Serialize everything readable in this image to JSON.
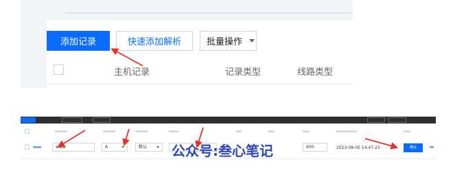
{
  "toolbar": {
    "add_record_label": "添加记录",
    "quick_add_label": "快速添加解析",
    "batch_label": "批量操作"
  },
  "table_header": {
    "host_record": "主机记录",
    "record_type": "记录类型",
    "line_type": "线路类型"
  },
  "edit_row": {
    "host_value": "www",
    "type_value": "A",
    "line_value": "默认",
    "ttl_value": "600",
    "last_modified": "2023-08-05 14:47:23",
    "confirm_label": "确认"
  },
  "watermark": "公众号:叁心笔记",
  "colors": {
    "primary": "#0a6cff",
    "arrow": "#e8302a",
    "watermark": "#2f46b9"
  }
}
